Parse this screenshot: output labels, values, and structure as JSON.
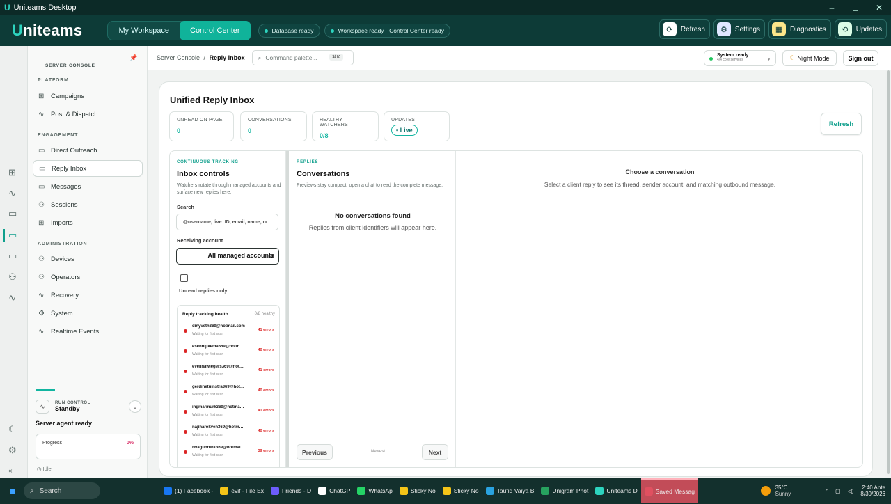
{
  "window": {
    "title": "Uniteams Desktop",
    "controls": [
      "–",
      "◻",
      "✕"
    ]
  },
  "appbar": {
    "logo_mark": "U",
    "logo_text": "niteams",
    "tabs": [
      "My Workspace",
      "Control Center"
    ],
    "status_pills": [
      "Database ready",
      "Workspace ready · Control Center ready"
    ],
    "buttons": [
      {
        "label": "Refresh",
        "icon": "refresh-icon",
        "glyph": "⟳",
        "color": "#ffffff"
      },
      {
        "label": "Settings",
        "icon": "gear-icon",
        "glyph": "⚙",
        "color": "#e0e7ff"
      },
      {
        "label": "Diagnostics",
        "icon": "diagnostics-icon",
        "glyph": "▦",
        "color": "#fde68a"
      },
      {
        "label": "Updates",
        "icon": "updates-icon",
        "glyph": "⟲",
        "color": "#dcfce7"
      }
    ]
  },
  "sidebar": {
    "header": "SERVER CONSOLE",
    "platform_label": "PLATFORM",
    "platform": [
      {
        "label": "Campaigns",
        "icon": "grid-icon",
        "glyph": "⊞"
      },
      {
        "label": "Post & Dispatch",
        "icon": "pulse-icon",
        "glyph": "∿"
      }
    ],
    "engagement_label": "ENGAGEMENT",
    "engagement": [
      {
        "label": "Direct Outreach",
        "icon": "message-icon",
        "glyph": "▭"
      },
      {
        "label": "Reply Inbox",
        "icon": "message-icon",
        "glyph": "▭"
      },
      {
        "label": "Messages",
        "icon": "message-icon",
        "glyph": "▭"
      },
      {
        "label": "Sessions",
        "icon": "users-icon",
        "glyph": "⚇"
      },
      {
        "label": "Imports",
        "icon": "grid-icon",
        "glyph": "⊞"
      }
    ],
    "administration_label": "ADMINISTRATION",
    "administration": [
      {
        "label": "Devices",
        "icon": "users-icon",
        "glyph": "⚇"
      },
      {
        "label": "Operators",
        "icon": "users-icon",
        "glyph": "⚇"
      },
      {
        "label": "Recovery",
        "icon": "pulse-icon",
        "glyph": "∿"
      },
      {
        "label": "System",
        "icon": "gear-icon",
        "glyph": "⚙"
      },
      {
        "label": "Realtime Events",
        "icon": "pulse-icon",
        "glyph": "∿"
      }
    ],
    "run_control": {
      "label": "RUN CONTROL",
      "value": "Standby"
    },
    "agent_status": "Server agent ready",
    "progress": {
      "label": "Progress",
      "value": "0%"
    },
    "idle": "Idle"
  },
  "header": {
    "crumb_root": "Server Console",
    "crumb_sep": "/",
    "crumb_current": "Reply Inbox",
    "command_placeholder": "Command palette...",
    "command_key": "⌘K",
    "system_status": "System ready",
    "system_sub": "4/4 core services",
    "night_mode": "Night Mode",
    "sign_out": "Sign out"
  },
  "main": {
    "title": "Unified Reply Inbox",
    "stats": [
      {
        "label": "UNREAD ON PAGE",
        "value": "0"
      },
      {
        "label": "CONVERSATIONS",
        "value": "0"
      },
      {
        "label": "HEALTHY WATCHERS",
        "value": "0/8"
      },
      {
        "label": "UPDATES",
        "value": "• Live"
      }
    ],
    "refresh": "Refresh",
    "controls": {
      "kicker": "CONTINUOUS TRACKING",
      "title": "Inbox controls",
      "desc": "Watchers rotate through managed accounts and surface new replies here.",
      "search_label": "Search",
      "search_placeholder": "@username, live: ID, email, name, or",
      "account_label": "Receiving account",
      "account_value": "All managed accounts",
      "unread_label": "Unread replies only",
      "health_title": "Reply tracking health",
      "health_count": "0/8 healthy",
      "watchers": [
        {
          "email": "dinyveth369@hotmail.com",
          "status": "Waiting for first scan",
          "errors": "41 errors"
        },
        {
          "email": "esenhijlkema369@hotmail.com",
          "status": "Waiting for first scan",
          "errors": "40 errors"
        },
        {
          "email": "evelinawiegers369@hotmail....",
          "status": "Waiting for first scan",
          "errors": "41 errors"
        },
        {
          "email": "gerdinetuinstra369@hotmail....",
          "status": "Waiting for first scan",
          "errors": "40 errors"
        },
        {
          "email": "ingmarmurk369@hotmail.com",
          "status": "Waiting for first scan",
          "errors": "41 errors"
        },
        {
          "email": "najiharokven369@hotmail.com",
          "status": "Waiting for first scan",
          "errors": "40 errors"
        },
        {
          "email": "rivagunnink369@hotmail.com",
          "status": "Waiting for first scan",
          "errors": "39 errors"
        }
      ]
    },
    "conversations": {
      "kicker": "REPLIES",
      "title": "Conversations",
      "desc": "Previews stay compact; open a chat to read the complete message.",
      "empty_title": "No conversations found",
      "empty_desc": "Replies from client identifiers will appear here.",
      "prev": "Previous",
      "newest": "Newest",
      "next": "Next"
    },
    "detail": {
      "title": "Choose a conversation",
      "desc": "Select a client reply to see its thread, sender account, and matching outbound message."
    }
  },
  "taskbar": {
    "search": "Search",
    "items": [
      "(1) Facebook -",
      "evif - File Ex",
      "Friends - D",
      "ChatGP",
      "WhatsAp",
      "Sticky No",
      "Sticky No",
      "Taufiq Vaiya B",
      "Unigram Phot",
      "Uniteams D",
      "Saved Messag"
    ],
    "weather_temp": "35°C",
    "weather_desc": "Sunny",
    "time": "2:40 Ante",
    "date": "8/30/2026"
  }
}
